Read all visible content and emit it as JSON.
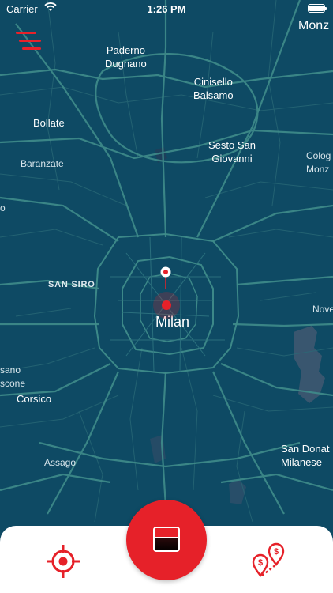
{
  "status_bar": {
    "carrier": "Carrier",
    "time": "1:26 PM"
  },
  "map": {
    "labels": [
      {
        "id": "monza",
        "text": "Monz"
      },
      {
        "id": "paderno",
        "text": "Paderno\nDugnano"
      },
      {
        "id": "cinisello",
        "text": "Cinisello\nBalsamo"
      },
      {
        "id": "bollate",
        "text": "Bollate"
      },
      {
        "id": "sesto",
        "text": "Sesto San\nGiovanni"
      },
      {
        "id": "cologno",
        "text": "Colog\nMonz"
      },
      {
        "id": "baranzate",
        "text": "Baranzate"
      },
      {
        "id": "o-edge",
        "text": "o"
      },
      {
        "id": "san-siro",
        "text": "SAN SIRO"
      },
      {
        "id": "milan",
        "text": "Milan"
      },
      {
        "id": "novate",
        "text": "Nove"
      },
      {
        "id": "sano",
        "text": "sano\nscone"
      },
      {
        "id": "corsico",
        "text": "Corsico"
      },
      {
        "id": "assago",
        "text": "Assago"
      },
      {
        "id": "san-donato",
        "text": "San Donat\nMilanese"
      }
    ]
  },
  "colors": {
    "map_background": "#0e4a64",
    "road": "#3f8c8a",
    "accent": "#e62129",
    "bottom_bar": "#ffffff"
  },
  "icons": {
    "menu": "hamburger-menu-icon",
    "locate": "crosshair-locate-icon",
    "scan": "scan-frame-icon",
    "prices": "price-pins-icon"
  }
}
